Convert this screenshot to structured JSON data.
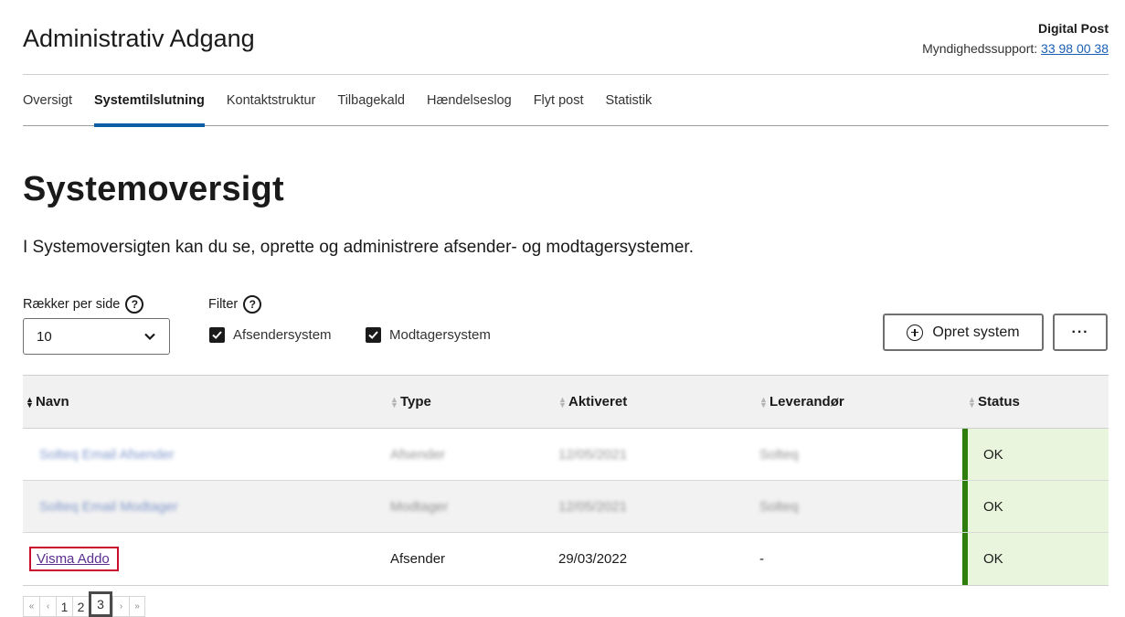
{
  "header": {
    "app_title": "Administrativ Adgang",
    "brand": "Digital Post",
    "support_label": "Myndighedssupport:",
    "support_phone": "33 98 00 38"
  },
  "nav": {
    "tabs": [
      {
        "label": "Oversigt",
        "active": false
      },
      {
        "label": "Systemtilslutning",
        "active": true
      },
      {
        "label": "Kontaktstruktur",
        "active": false
      },
      {
        "label": "Tilbagekald",
        "active": false
      },
      {
        "label": "Hændelseslog",
        "active": false
      },
      {
        "label": "Flyt post",
        "active": false
      },
      {
        "label": "Statistik",
        "active": false
      }
    ]
  },
  "page": {
    "title": "Systemoversigt",
    "intro": "I Systemoversigten kan du se, oprette og administrere afsender- og modtagersystemer."
  },
  "controls": {
    "rows_per_page_label": "Rækker per side",
    "rows_per_page_value": "10",
    "filter_label": "Filter",
    "filters": [
      {
        "label": "Afsendersystem",
        "checked": true
      },
      {
        "label": "Modtagersystem",
        "checked": true
      }
    ],
    "create_button": "Opret system",
    "more_button": "···"
  },
  "table": {
    "columns": [
      "Navn",
      "Type",
      "Aktiveret",
      "Leverandør",
      "Status"
    ],
    "rows": [
      {
        "name": "Solteq Email Afsender",
        "type": "Afsender",
        "activated": "12/05/2021",
        "vendor": "Solteq",
        "status": "OK",
        "blurred": true
      },
      {
        "name": "Solteq Email Modtager",
        "type": "Modtager",
        "activated": "12/05/2021",
        "vendor": "Solteq",
        "status": "OK",
        "blurred": true
      },
      {
        "name": "Visma Addo",
        "type": "Afsender",
        "activated": "29/03/2022",
        "vendor": "-",
        "status": "OK",
        "blurred": false
      }
    ],
    "status_color": "#2e7d0d",
    "status_bg": "#e9f6dd"
  },
  "pagination": {
    "first": "«",
    "prev": "‹",
    "pages": [
      "1",
      "2",
      "3"
    ],
    "current": "3",
    "next": "›",
    "last": "»"
  }
}
